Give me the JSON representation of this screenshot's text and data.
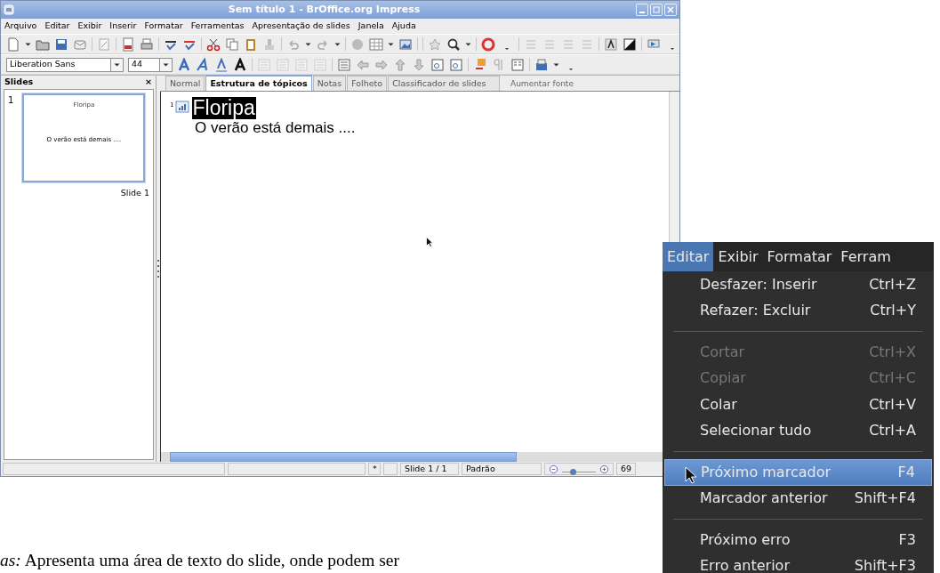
{
  "window": {
    "title": "Sem título 1 - BrOffice.org Impress"
  },
  "menu": [
    "Arquivo",
    "Editar",
    "Exibir",
    "Inserir",
    "Formatar",
    "Ferramentas",
    "Apresentação de slides",
    "Janela",
    "Ajuda"
  ],
  "font_box": {
    "value": "Liberation Sans"
  },
  "size_box": {
    "value": "44"
  },
  "slides_panel": {
    "title": "Slides",
    "close": "×",
    "slides": [
      {
        "number": "1",
        "title": "Floripa",
        "body": "O verão está demais ....",
        "label": "Slide 1",
        "selected": true
      }
    ]
  },
  "tabs": [
    {
      "label": "Normal",
      "selected": false
    },
    {
      "label": "Estrutura de tópicos",
      "selected": true
    },
    {
      "label": "Notas",
      "selected": false
    },
    {
      "label": "Folheto",
      "selected": false
    },
    {
      "label": "Classificador de slides",
      "selected": false
    }
  ],
  "tooltip": "Aumentar fonte",
  "outline": [
    {
      "number": "1",
      "title": "Floripa",
      "points": [
        "O verão está demais ...."
      ]
    }
  ],
  "status_bar": {
    "modified": "*",
    "slide": "Slide 1 / 1",
    "layout": "Padrão",
    "zoom_slider": {
      "level": 0.31
    },
    "zoom": "69"
  },
  "popup_menu": {
    "bar": [
      {
        "label": "Editar",
        "selected": true
      },
      {
        "label": "Exibir",
        "selected": false
      },
      {
        "label": "Formatar",
        "selected": false
      },
      {
        "label": "Ferram",
        "selected": false
      }
    ],
    "items": [
      {
        "kind": "item",
        "label": "Desfazer: Inserir",
        "shortcut": "Ctrl+Z",
        "disabled": false,
        "selected": false
      },
      {
        "kind": "item",
        "label": "Refazer: Excluir",
        "shortcut": "Ctrl+Y",
        "disabled": false,
        "selected": false
      },
      {
        "kind": "separator"
      },
      {
        "kind": "item",
        "label": "Cortar",
        "shortcut": "Ctrl+X",
        "disabled": true,
        "selected": false
      },
      {
        "kind": "item",
        "label": "Copiar",
        "shortcut": "Ctrl+C",
        "disabled": true,
        "selected": false
      },
      {
        "kind": "item",
        "label": "Colar",
        "shortcut": "Ctrl+V",
        "disabled": false,
        "selected": false
      },
      {
        "kind": "item",
        "label": "Selecionar tudo",
        "shortcut": "Ctrl+A",
        "disabled": false,
        "selected": false
      },
      {
        "kind": "separator"
      },
      {
        "kind": "item",
        "label": "Próximo marcador",
        "shortcut": "F4",
        "disabled": false,
        "selected": true
      },
      {
        "kind": "item",
        "label": "Marcador anterior",
        "shortcut": "Shift+F4",
        "disabled": false,
        "selected": false
      },
      {
        "kind": "separator"
      },
      {
        "kind": "item",
        "label": "Próximo erro",
        "shortcut": "F3",
        "disabled": false,
        "selected": false
      },
      {
        "kind": "item",
        "label": "Erro anterior",
        "shortcut": "Shift+F3",
        "disabled": false,
        "selected": false
      }
    ]
  },
  "caption": "*as:* Apresenta uma área de texto do slide, onde podem ser"
}
